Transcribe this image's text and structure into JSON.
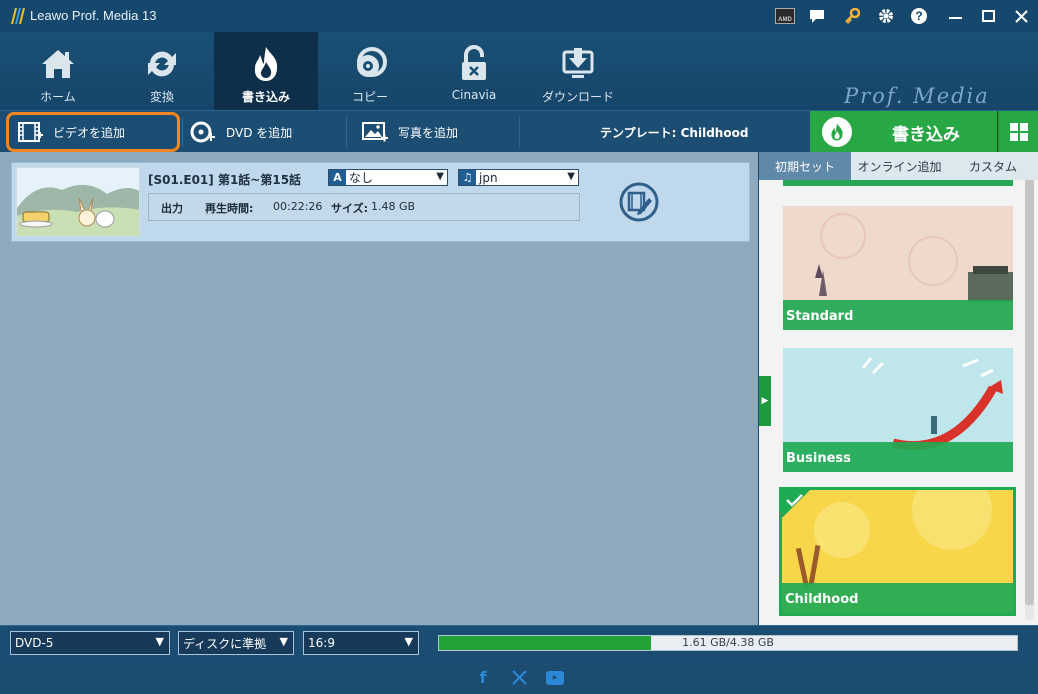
{
  "app": {
    "title": "Leawo Prof. Media 13"
  },
  "nav": {
    "tabs": [
      {
        "label": "ホーム"
      },
      {
        "label": "変換"
      },
      {
        "label": "書き込み"
      },
      {
        "label": "コピー"
      },
      {
        "label": "Cinavia"
      },
      {
        "label": "ダウンロード"
      }
    ],
    "brand": "Prof. Media"
  },
  "toolbar": {
    "add_video": "ビデオを追加",
    "add_dvd": "DVD を追加",
    "add_photo": "写真を追加",
    "template": "テンプレート: Childhood",
    "burn": "書き込み"
  },
  "item": {
    "title": "[S01.E01] 第1話~第15話",
    "subtitle_select": "なし",
    "audio_select": "jpn",
    "output_label": "出力",
    "duration_label": "再生時間:",
    "duration": "00:22:26",
    "size_label": "サイズ:",
    "size": "1.48 GB"
  },
  "panel": {
    "tabs": [
      "初期セット",
      "オンライン追加",
      "カスタム"
    ],
    "templates": [
      {
        "label": "Standard"
      },
      {
        "label": "Business"
      },
      {
        "label": "Childhood",
        "selected": true
      }
    ]
  },
  "bottom": {
    "disc_type": "DVD-5",
    "quality": "ディスクに準拠",
    "aspect": "16:9",
    "usage_text": "1.61 GB/4.38 GB",
    "usage_fraction": 0.3676
  },
  "colors": {
    "accent_orange": "#f5861f",
    "green": "#28a745",
    "nav_bg": "#1a5075"
  },
  "icons": [
    "facebook-icon",
    "x-icon",
    "youtube-icon"
  ]
}
